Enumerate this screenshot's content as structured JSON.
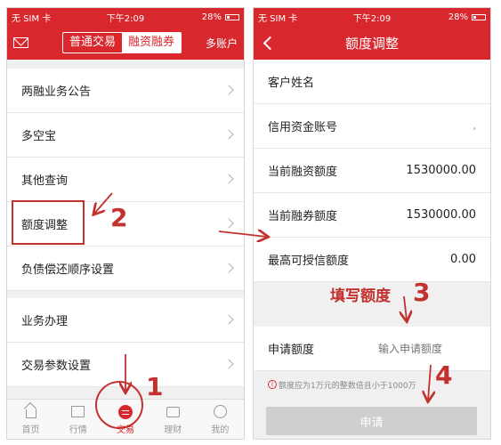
{
  "status_bar": {
    "carrier": "无 SIM 卡",
    "time": "下午2:09",
    "battery": "28%"
  },
  "left_screen": {
    "tabs": [
      "普通交易",
      "融资融券"
    ],
    "active_tab": "融资融券",
    "multi_account": "多账户",
    "menu_group1": [
      "两融业务公告",
      "多空宝",
      "其他查询",
      "额度调整",
      "负债偿还顺序设置"
    ],
    "menu_group2": [
      "业务办理",
      "交易参数设置"
    ],
    "tabbar": [
      "首页",
      "行情",
      "交易",
      "理财",
      "我的"
    ],
    "active_tab_index": 2
  },
  "right_screen": {
    "title": "额度调整",
    "fields": [
      {
        "label": "客户姓名",
        "value": ""
      },
      {
        "label": "信用资金账号",
        "value": ""
      },
      {
        "label": "当前融资额度",
        "value": "1530000.00"
      },
      {
        "label": "当前融券额度",
        "value": "1530000.00"
      },
      {
        "label": "最高可授信额度",
        "value": "0.00"
      }
    ],
    "apply_label": "申请额度",
    "apply_placeholder": "输入申请额度",
    "notice": "额度应为1万元的整数倍且小于1000万",
    "submit_label": "申请"
  },
  "annotations": {
    "step1": "1",
    "step2": "2",
    "step3": "3",
    "step4": "4",
    "fill_label": "填写额度"
  },
  "colors": {
    "brand_red": "#d9272e",
    "annotation_red": "#c3312e"
  }
}
